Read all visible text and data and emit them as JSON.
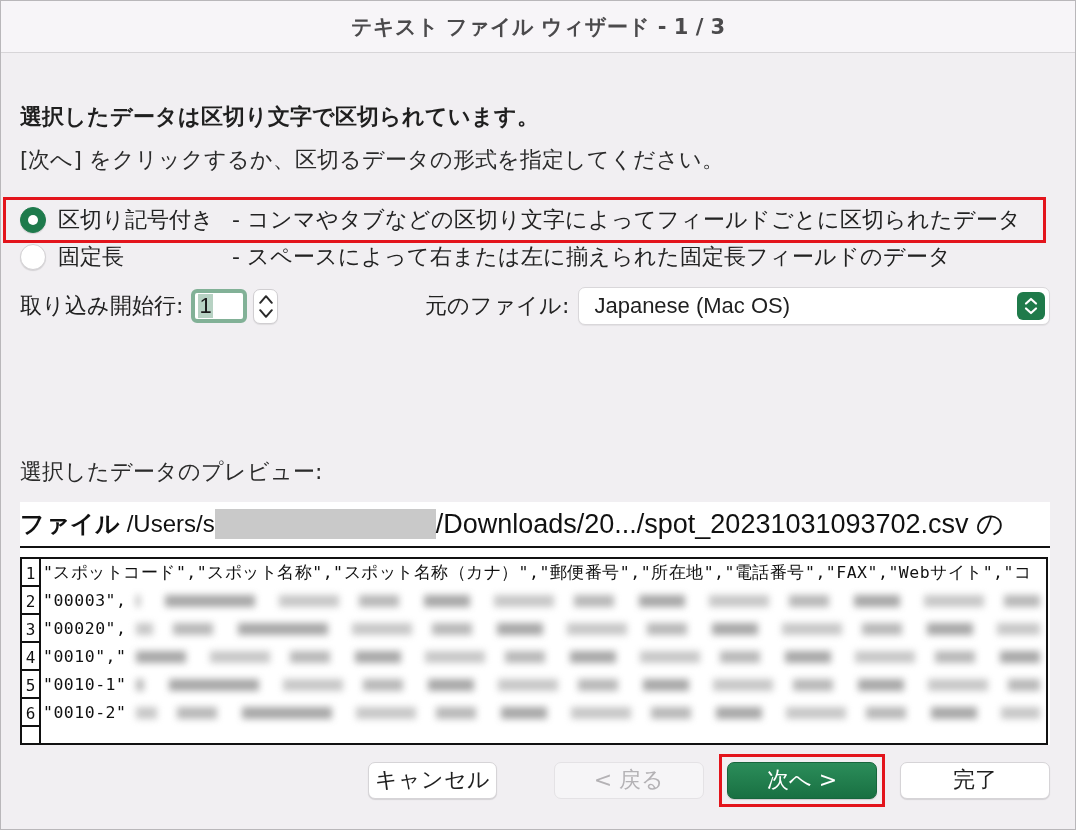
{
  "window": {
    "title": "テキスト ファイル ウィザード - 1 / 3"
  },
  "instructions": {
    "heading": "選択したデータは区切り文字で区切られています。",
    "text": "[次へ] をクリックするか、区切るデータの形式を指定してください。"
  },
  "data_types": [
    {
      "label": "区切り記号付き",
      "description": "- コンマやタブなどの区切り文字によってフィールドごとに区切られたデータ",
      "selected": true,
      "highlighted": true
    },
    {
      "label": "固定長",
      "description": "- スペースによって右または左に揃えられた固定長フィールドのデータ",
      "selected": false,
      "highlighted": false
    }
  ],
  "start_row": {
    "label": "取り込み開始行:",
    "value": "1",
    "focused": true
  },
  "file_origin": {
    "label": "元のファイル:",
    "value": "Japanese (Mac OS)"
  },
  "preview": {
    "label": "選択したデータのプレビュー:",
    "file_path_start": "**ファイル** /Users/s",
    "file_path_end": "/Downloads/20.../spot_20231031093702.csv の",
    "rows": [
      {
        "number": "1",
        "text": "\"スポットコード\",\"スポット名称\",\"スポット名称（カナ）\",\"郵便番号\",\"所在地\",\"電話番号\",\"FAX\",\"Webサイト\",\"コ",
        "kind": "plain"
      },
      {
        "number": "2",
        "text": "\"00003\",",
        "kind": "blurred"
      },
      {
        "number": "3",
        "text": "\"00020\",",
        "kind": "blurred"
      },
      {
        "number": "4",
        "text": "\"0010\",\"",
        "kind": "blurred"
      },
      {
        "number": "5",
        "text": "\"0010-1\"",
        "kind": "blurred"
      },
      {
        "number": "6",
        "text": "\"0010-2\"",
        "kind": "blurred"
      }
    ]
  },
  "buttons": [
    {
      "label": "キャンセル",
      "kind": "cancel",
      "disabled": false,
      "highlighted": false
    },
    {
      "label": "< 戻る",
      "kind": "default",
      "disabled": true,
      "highlighted": false
    },
    {
      "label": "次へ >",
      "kind": "primary",
      "disabled": false,
      "highlighted": true
    },
    {
      "label": "完了",
      "kind": "default",
      "disabled": false,
      "highlighted": false
    }
  ]
}
